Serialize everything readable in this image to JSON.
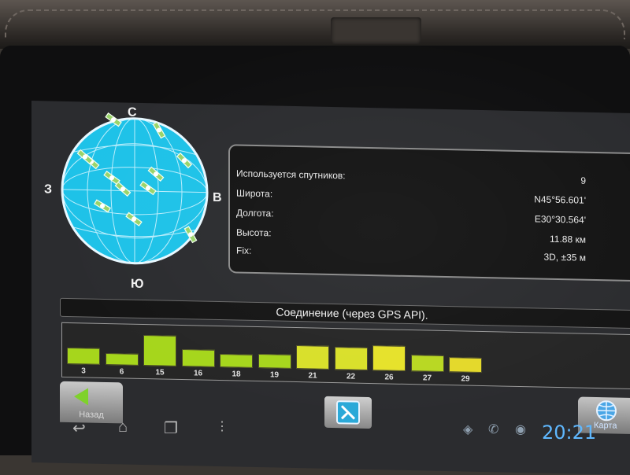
{
  "sky": {
    "north": "С",
    "south": "Ю",
    "west": "З",
    "east": "В"
  },
  "info": {
    "rows": [
      {
        "label": "Используется спутников:",
        "value": "9"
      },
      {
        "label": "Широта:",
        "value": "N45°56.601'"
      },
      {
        "label": "Долгота:",
        "value": "E30°30.564'"
      },
      {
        "label": "Высота:",
        "value": "11.88 км"
      },
      {
        "label": "Fix:",
        "value": "3D, ±35 м"
      }
    ]
  },
  "status_text": "Соединение (через GPS API).",
  "signals": [
    {
      "prn": "3",
      "level": 0.45,
      "color": "#a6d61c"
    },
    {
      "prn": "6",
      "level": 0.33,
      "color": "#a6d61c"
    },
    {
      "prn": "15",
      "level": 0.85,
      "color": "#a6d61c"
    },
    {
      "prn": "16",
      "level": 0.48,
      "color": "#a6d61c"
    },
    {
      "prn": "18",
      "level": 0.38,
      "color": "#a6d61c"
    },
    {
      "prn": "19",
      "level": 0.4,
      "color": "#a6d61c"
    },
    {
      "prn": "21",
      "level": 0.66,
      "color": "#d9e02a"
    },
    {
      "prn": "22",
      "level": 0.63,
      "color": "#d9e02a"
    },
    {
      "prn": "26",
      "level": 0.7,
      "color": "#e6e22a"
    },
    {
      "prn": "27",
      "level": 0.46,
      "color": "#b8d822"
    },
    {
      "prn": "29",
      "level": 0.42,
      "color": "#e4d92a"
    }
  ],
  "buttons": {
    "back_label": "Назад",
    "map_label": "Карта"
  },
  "clock": "20:21",
  "icons": [
    "back-arrow-icon",
    "satellite-icon",
    "globe-icon",
    "nav-back-icon",
    "nav-home-icon",
    "nav-recents-icon",
    "menu-dots-icon",
    "gps-icon",
    "chat-icon",
    "gamepad-icon"
  ],
  "colors": {
    "sky_fill": "#1ec2e8",
    "signal_green": "#a6d61c",
    "signal_yellow": "#e6e22a",
    "clock_blue": "#5fb8ff"
  }
}
